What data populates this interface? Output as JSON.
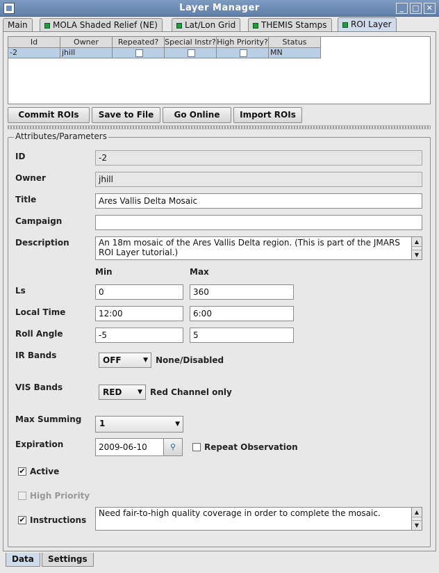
{
  "window": {
    "title": "Layer Manager"
  },
  "tabs": [
    {
      "label": "Main",
      "dot": false
    },
    {
      "label": "MOLA Shaded Relief (NE)",
      "dot": true
    },
    {
      "label": "Lat/Lon Grid",
      "dot": true
    },
    {
      "label": "THEMIS Stamps",
      "dot": true
    },
    {
      "label": "ROI Layer",
      "dot": true
    }
  ],
  "table": {
    "columns": [
      "Id",
      "Owner",
      "Repeated?",
      "Special Instr?",
      "High Priority?",
      "Status"
    ],
    "rows": [
      {
        "id": "-2",
        "owner": "jhill",
        "repeated": false,
        "special": false,
        "high": false,
        "status": "MN"
      }
    ]
  },
  "buttons": {
    "commit": "Commit ROIs",
    "save": "Save to File",
    "online": "Go Online",
    "import": "Import ROIs"
  },
  "form": {
    "group_title": "Attributes/Parameters",
    "id_label": "ID",
    "id_value": "-2",
    "owner_label": "Owner",
    "owner_value": "jhill",
    "title_label": "Title",
    "title_value": "Ares Vallis Delta Mosaic",
    "campaign_label": "Campaign",
    "campaign_value": "",
    "description_label": "Description",
    "description_value": "An 18m mosaic of the Ares Vallis Delta region. (This is part of the JMARS ROI Layer tutorial.)",
    "min_header": "Min",
    "max_header": "Max",
    "ls_label": "Ls",
    "ls_min": "0",
    "ls_max": "360",
    "localtime_label": "Local Time",
    "localtime_min": "12:00",
    "localtime_max": "6:00",
    "roll_label": "Roll Angle",
    "roll_min": "-5",
    "roll_max": "5",
    "ir_label": "IR Bands",
    "ir_value": "OFF",
    "ir_desc": "None/Disabled",
    "vis_label": "VIS Bands",
    "vis_value": "RED",
    "vis_desc": "Red Channel only",
    "summing_label": "Max Summing",
    "summing_value": "1",
    "expiration_label": "Expiration",
    "expiration_value": "2009-06-10",
    "repeat_label": "Repeat Observation",
    "repeat_checked": false,
    "active_label": "Active",
    "active_checked": true,
    "high_priority_label": "High Priority",
    "high_priority_checked": false,
    "instructions_label": "Instructions",
    "instructions_checked": true,
    "instructions_value": "Need fair-to-high quality coverage in order to complete the mosaic."
  },
  "bottom_tabs": [
    "Data",
    "Settings"
  ]
}
